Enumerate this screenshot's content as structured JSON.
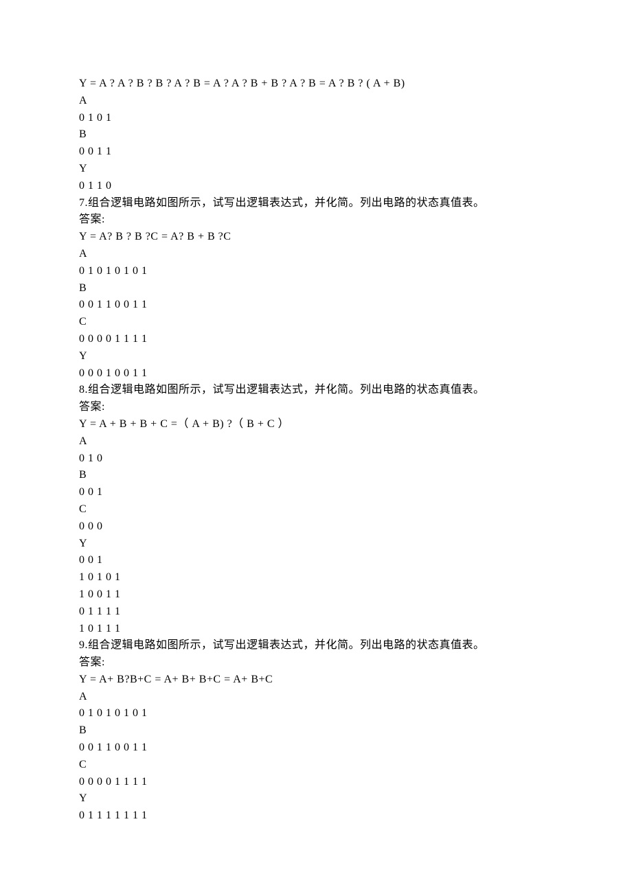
{
  "lines": [
    "Y = A ? A ? B ? B ? A ? B = A ? A ? B + B ? A ? B = A ? B ? ( A + B)",
    "A",
    "0 1 0 1",
    "B",
    "0 0 1 1",
    "Y",
    "0 1 1 0",
    "7.组合逻辑电路如图所示，试写出逻辑表达式，并化简。列出电路的状态真值表。",
    "答案:",
    "Y = A? B ? B ?C = A? B + B ?C",
    "A",
    "0 1 0 1 0 1 0 1",
    "B",
    "0 0 1 1 0 0 1 1",
    "C",
    "0 0 0 0 1 1 1 1",
    "Y",
    "0 0 0 1 0 0 1 1",
    "8.组合逻辑电路如图所示，试写出逻辑表达式，并化简。列出电路的状态真值表。",
    "答案:",
    "Y = A + B + B + C =（ A + B) ?（ B + C ）",
    "A",
    "0 1 0",
    "B",
    "0 0 1",
    "C",
    "0 0 0",
    "Y",
    "0 0 1",
    "1 0 1 0 1",
    "1 0 0 1 1",
    "0 1 1 1 1",
    "1 0 1 1 1",
    "9.组合逻辑电路如图所示，试写出逻辑表达式，并化简。列出电路的状态真值表。",
    "答案:",
    "Y = A+ B?B+C = A+ B+ B+C = A+ B+C",
    "A",
    "0 1 0 1 0 1 0 1",
    "B",
    "0 0 1 1 0 0 1 1",
    "C",
    "0 0 0 0 1 1 1 1",
    "Y",
    "0 1 1 1 1 1 1 1"
  ]
}
